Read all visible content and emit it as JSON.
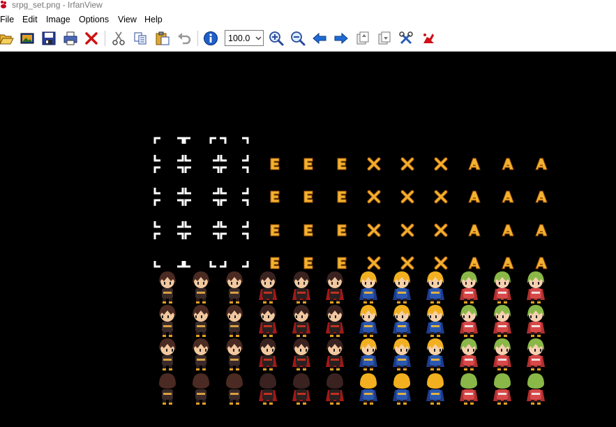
{
  "window": {
    "title": "srpg_set.png - IrfanView",
    "app_icon": "red-paw-icon"
  },
  "menu": {
    "items": [
      "File",
      "Edit",
      "Image",
      "Options",
      "View",
      "Help"
    ]
  },
  "toolbar": {
    "zoom_value": "100.0",
    "icons": {
      "open": "folder-open-icon",
      "slideshow": "slideshow-icon",
      "save": "save-disk-icon",
      "print": "printer-icon",
      "delete": "delete-x-icon",
      "cut": "scissors-icon",
      "copy": "copy-icon",
      "paste": "paste-icon",
      "undo": "undo-icon",
      "info": "info-icon",
      "zoom_in": "zoom-in-icon",
      "zoom_out": "zoom-out-icon",
      "previous": "arrow-left-icon",
      "next": "arrow-right-icon",
      "prev_page": "page-up-icon",
      "next_page": "page-down-icon",
      "properties": "tools-icon",
      "about": "irfanview-paw-icon"
    }
  },
  "image": {
    "rows": [
      {
        "groups": [
          "cursor",
          "E",
          "X",
          "A"
        ]
      },
      {
        "groups": [
          "cursor",
          "E",
          "X",
          "A"
        ]
      },
      {
        "groups": [
          "cursor",
          "E",
          "X",
          "A"
        ]
      },
      {
        "groups": [
          "cursor",
          "E",
          "X",
          "A"
        ]
      }
    ],
    "characters": [
      "dark-haired-swordsman",
      "dark-haired-caped-warrior",
      "blond-knight",
      "green-haired-girl"
    ],
    "colors": {
      "letters": "#f2b230",
      "letter_outline": "#a85a08",
      "cursor": "#ffffff",
      "background": "#000000"
    }
  }
}
